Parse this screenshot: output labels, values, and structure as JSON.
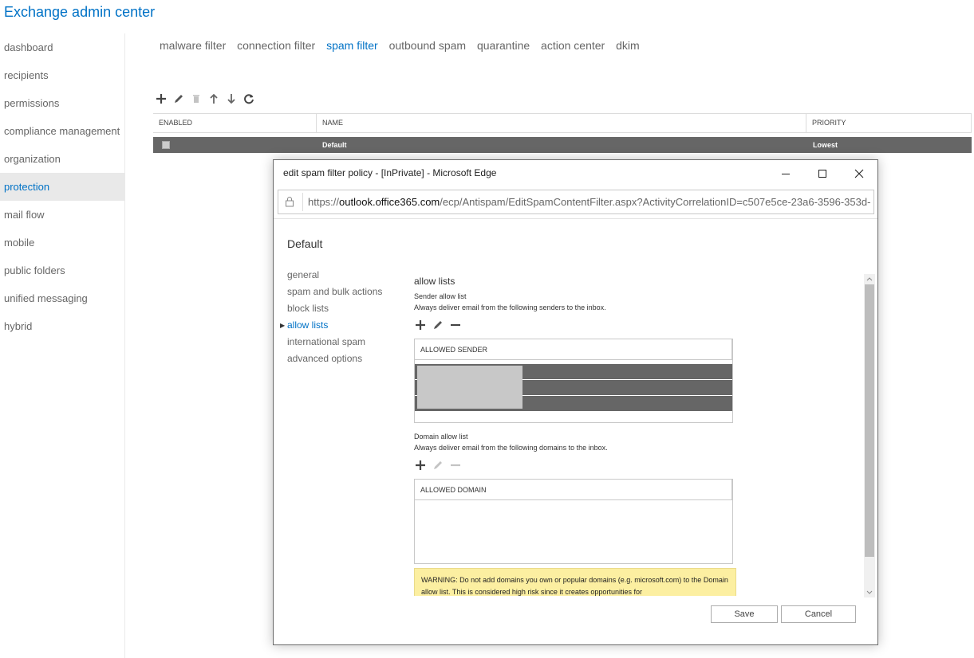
{
  "app": {
    "title": "Exchange admin center"
  },
  "nav": {
    "items": [
      {
        "label": "dashboard"
      },
      {
        "label": "recipients"
      },
      {
        "label": "permissions"
      },
      {
        "label": "compliance management"
      },
      {
        "label": "organization"
      },
      {
        "label": "protection",
        "active": true
      },
      {
        "label": "mail flow"
      },
      {
        "label": "mobile"
      },
      {
        "label": "public folders"
      },
      {
        "label": "unified messaging"
      },
      {
        "label": "hybrid"
      }
    ]
  },
  "tabs": [
    {
      "label": "malware filter"
    },
    {
      "label": "connection filter"
    },
    {
      "label": "spam filter",
      "active": true
    },
    {
      "label": "outbound spam"
    },
    {
      "label": "quarantine"
    },
    {
      "label": "action center"
    },
    {
      "label": "dkim"
    }
  ],
  "toolbar": {
    "icons": [
      "add-icon",
      "edit-icon",
      "delete-icon",
      "move-up-icon",
      "move-down-icon",
      "refresh-icon"
    ]
  },
  "grid": {
    "columns": [
      "ENABLED",
      "NAME",
      "PRIORITY"
    ],
    "rows": [
      {
        "enabled": true,
        "name": "Default",
        "priority": "Lowest"
      }
    ]
  },
  "popup": {
    "window_title": "edit spam filter policy - [InPrivate] - Microsoft Edge",
    "url_prefix": "https://",
    "url_domain": "outlook.office365.com",
    "url_path": "/ecp/Antispam/EditSpamContentFilter.aspx?ActivityCorrelationID=c507e5ce-23a6-3596-353d-",
    "policy_name": "Default",
    "subnav": [
      {
        "label": "general"
      },
      {
        "label": "spam and bulk actions"
      },
      {
        "label": "block lists"
      },
      {
        "label": "allow lists",
        "active": true
      },
      {
        "label": "international spam"
      },
      {
        "label": "advanced options"
      }
    ],
    "section_title": "allow lists",
    "sender": {
      "title": "Sender allow list",
      "description": "Always deliver email from the following senders to the inbox.",
      "column": "ALLOWED SENDER"
    },
    "domain": {
      "title": "Domain allow list",
      "description": "Always deliver email from the following domains to the inbox.",
      "column": "ALLOWED DOMAIN"
    },
    "warning_text": "WARNING: Do not add domains you own or popular domains (e.g. microsoft.com) to the Domain allow list. This is considered high risk since it creates opportunities for",
    "save_label": "Save",
    "cancel_label": "Cancel"
  },
  "colors": {
    "accent": "#0072c6",
    "selected_row": "#666666",
    "warning_bg": "#fcefa1"
  }
}
